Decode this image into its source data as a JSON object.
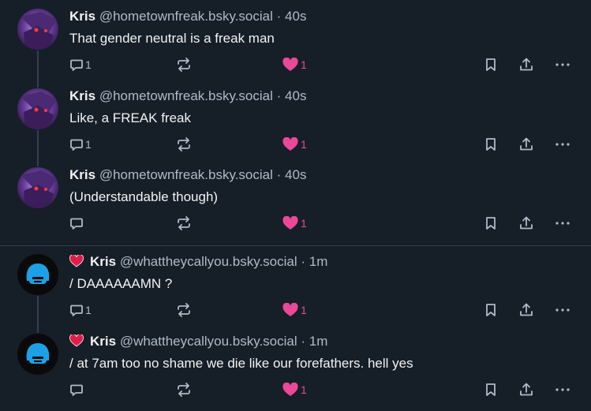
{
  "posts": [
    {
      "author": "Kris",
      "handle": "@hometownfreak.bsky.social",
      "separator": "·",
      "time": "40s",
      "text": "That gender neutral is a freak man",
      "replies": "1",
      "reposts": "",
      "likes": "1"
    },
    {
      "author": "Kris",
      "handle": "@hometownfreak.bsky.social",
      "separator": "·",
      "time": "40s",
      "text": "Like, a FREAK freak",
      "replies": "1",
      "reposts": "",
      "likes": "1"
    },
    {
      "author": "Kris",
      "handle": "@hometownfreak.bsky.social",
      "separator": "·",
      "time": "40s",
      "text": "(Understandable though)",
      "replies": "",
      "reposts": "",
      "likes": "1"
    },
    {
      "author": "Kris",
      "handle": "@whattheycallyou.bsky.social",
      "separator": "·",
      "time": "1m",
      "text": "/ DAAAAAAMN ?",
      "replies": "1",
      "reposts": "",
      "likes": "1"
    },
    {
      "author": "Kris",
      "handle": "@whattheycallyou.bsky.social",
      "separator": "·",
      "time": "1m",
      "text": "/ at 7am too no shame we die like our forefathers. hell yes",
      "replies": "",
      "reposts": "",
      "likes": "1"
    }
  ],
  "colors": {
    "background": "#161e27",
    "text": "#f1f3f5",
    "muted": "#aebbc9",
    "like": "#ec4899",
    "badge": "#e11d48"
  },
  "icons": [
    "reply-icon",
    "repost-icon",
    "like-icon",
    "bookmark-icon",
    "share-icon",
    "more-icon",
    "heart-badge-icon"
  ]
}
